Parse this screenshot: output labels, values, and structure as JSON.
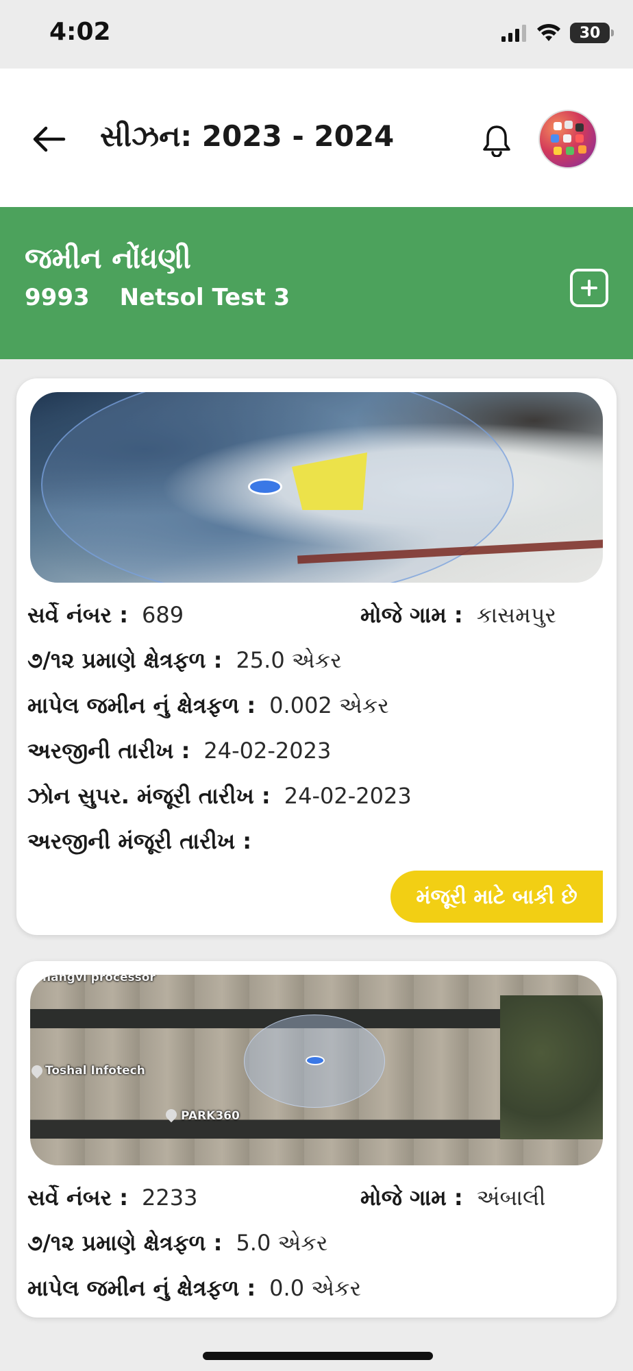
{
  "status_bar": {
    "time": "4:02",
    "battery": "30"
  },
  "header": {
    "season_title": "સીઝન: 2023 - 2024"
  },
  "banner": {
    "title": "જમીન નોંધણી",
    "code": "9993",
    "name": "Netsol Test 3",
    "color": "#4ca25c"
  },
  "cards": [
    {
      "survey_label": "સર્વે નંબર :",
      "survey_value": "689",
      "village_label": "મોજે ગામ :",
      "village_value": "કાસમપુર",
      "area_712_label": "૭/૧૨ પ્રમાણે ક્ષેત્રફળ :",
      "area_712_value": "25.0 એકર",
      "measured_label": "માપેલ જમીન નું ક્ષેત્રફળ :",
      "measured_value": "0.002 એકર",
      "app_date_label": "અરજીની તારીખ :",
      "app_date_value": "24-02-2023",
      "zone_date_label": "ઝોન સુપર. મંજૂરી તારીખ :",
      "zone_date_value": "24-02-2023",
      "approval_date_label": "અરજીની મંજૂરી તારીખ :",
      "approval_date_value": "",
      "status": "મંજૂરી માટે બાકી છે",
      "status_color": "#f2cf14"
    },
    {
      "map_labels": [
        "hangvi processor",
        "Toshal Infotech",
        "PARK360"
      ],
      "survey_label": "સર્વે નંબર :",
      "survey_value": "2233",
      "village_label": "મોજે ગામ :",
      "village_value": "અંબાલી",
      "area_712_label": "૭/૧૨ પ્રમાણે ક્ષેત્રફળ :",
      "area_712_value": "5.0 એકર",
      "measured_label": "માપેલ જમીન નું ક્ષેત્રફળ :",
      "measured_value": "0.0 એકર"
    }
  ],
  "icons": {
    "back": "back-arrow-icon",
    "bell": "bell-icon",
    "add": "add-square-icon"
  }
}
